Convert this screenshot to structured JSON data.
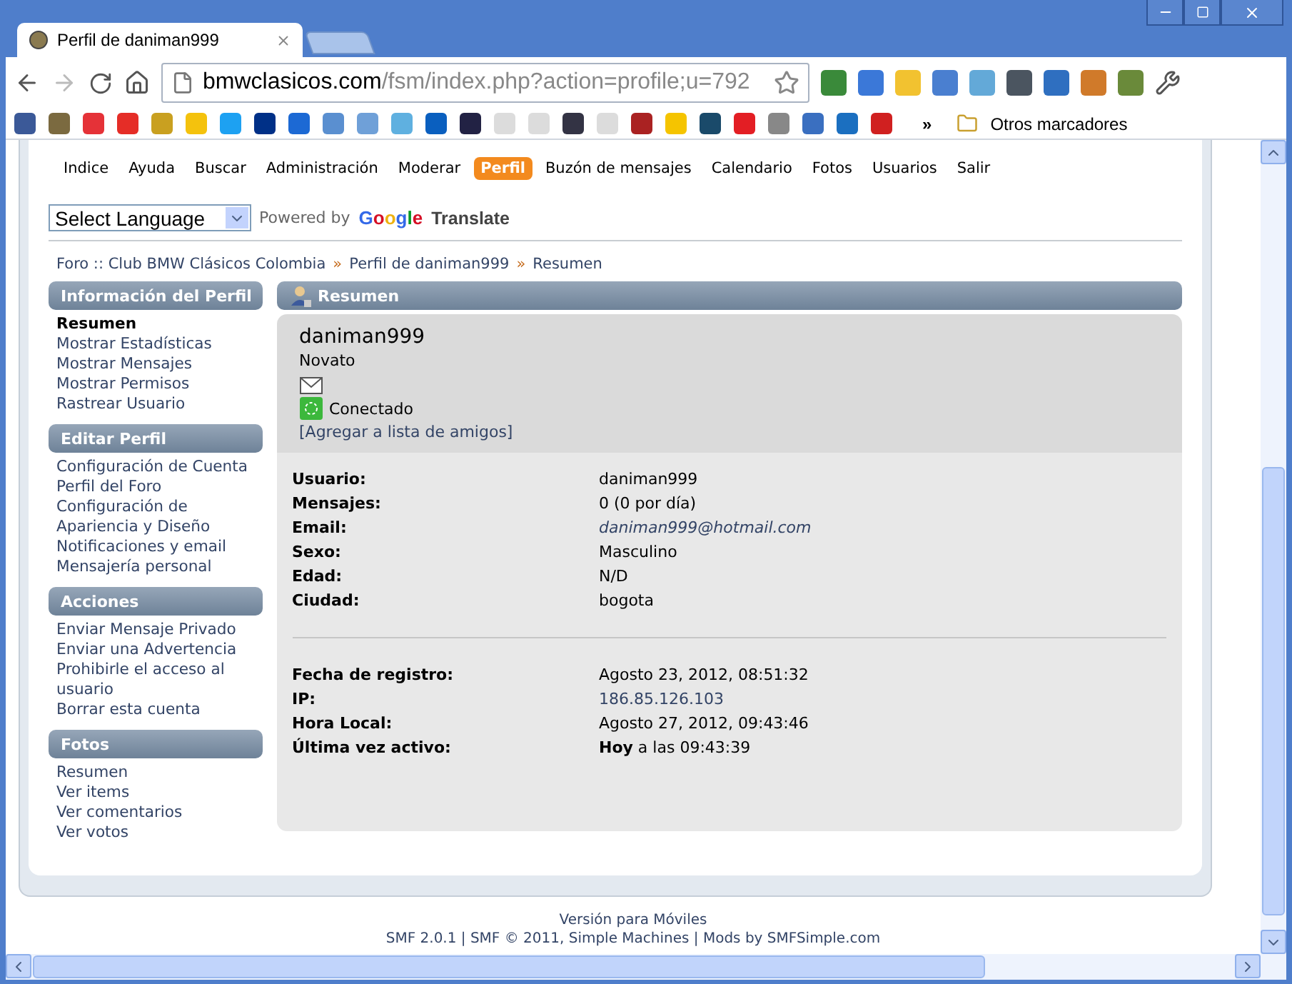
{
  "window": {
    "tab_title": "Perfil de daniman999",
    "url_domain": "bmwclasicos.com",
    "url_path": "/fsm/index.php?action=profile;u=792"
  },
  "bookmarks": {
    "more": "»",
    "other": "Otros marcadores"
  },
  "menu": [
    {
      "label": "Indice",
      "selected": false
    },
    {
      "label": "Ayuda",
      "selected": false
    },
    {
      "label": "Buscar",
      "selected": false
    },
    {
      "label": "Administración",
      "selected": false
    },
    {
      "label": "Moderar",
      "selected": false
    },
    {
      "label": "Perfil",
      "selected": true
    },
    {
      "label": "Buzón de mensajes",
      "selected": false
    },
    {
      "label": "Calendario",
      "selected": false
    },
    {
      "label": "Fotos",
      "selected": false
    },
    {
      "label": "Usuarios",
      "selected": false
    },
    {
      "label": "Salir",
      "selected": false
    }
  ],
  "translate": {
    "select": "Select Language",
    "powered_by": "Powered by",
    "brand": "Google",
    "product": "Translate"
  },
  "breadcrumb_separator": "»",
  "breadcrumb": [
    "Foro :: Club BMW Clásicos Colombia",
    "Perfil de daniman999",
    "Resumen"
  ],
  "sidebar": [
    {
      "title": "Información del Perfil",
      "items": [
        {
          "label": "Resumen",
          "selected": true
        },
        {
          "label": "Mostrar Estadísticas",
          "selected": false
        },
        {
          "label": "Mostrar Mensajes",
          "selected": false
        },
        {
          "label": "Mostrar Permisos",
          "selected": false
        },
        {
          "label": "Rastrear Usuario",
          "selected": false
        }
      ]
    },
    {
      "title": "Editar Perfil",
      "items": [
        {
          "label": "Configuración de Cuenta",
          "selected": false
        },
        {
          "label": "Perfil del Foro",
          "selected": false
        },
        {
          "label": "Configuración de Apariencia y Diseño",
          "selected": false
        },
        {
          "label": "Notificaciones y email",
          "selected": false
        },
        {
          "label": "Mensajería personal",
          "selected": false
        }
      ]
    },
    {
      "title": "Acciones",
      "items": [
        {
          "label": "Enviar Mensaje Privado",
          "selected": false
        },
        {
          "label": "Enviar una Advertencia",
          "selected": false
        },
        {
          "label": "Prohibirle el acceso al usuario",
          "selected": false
        },
        {
          "label": "Borrar esta cuenta",
          "selected": false
        }
      ]
    },
    {
      "title": "Fotos",
      "items": [
        {
          "label": "Resumen",
          "selected": false
        },
        {
          "label": "Ver items",
          "selected": false
        },
        {
          "label": "Ver comentarios",
          "selected": false
        },
        {
          "label": "Ver votos",
          "selected": false
        }
      ]
    }
  ],
  "summary": {
    "title": "Resumen",
    "username": "daniman999",
    "rank": "Novato",
    "online": true,
    "status": "Conectado",
    "add_buddy": "[Agregar a lista de amigos]"
  },
  "details": [
    [
      {
        "label": "Usuario:",
        "value": "daniman999",
        "kind": "text"
      },
      {
        "label": "Mensajes:",
        "value": "0 (0 por día)",
        "kind": "text"
      },
      {
        "label": "Email:",
        "value": "daniman999@hotmail.com",
        "kind": "email"
      },
      {
        "label": "Sexo:",
        "value": "Masculino",
        "kind": "text"
      },
      {
        "label": "Edad:",
        "value": "N/D",
        "kind": "text"
      },
      {
        "label": "Ciudad:",
        "value": "bogota",
        "kind": "text"
      }
    ],
    [
      {
        "label": "Fecha de registro:",
        "value": "Agosto 23, 2012, 08:51:32",
        "kind": "text"
      },
      {
        "label": "IP:",
        "value": "186.85.126.103",
        "kind": "link"
      },
      {
        "label": "Hora Local:",
        "value": "Agosto 27, 2012, 09:43:46",
        "kind": "text"
      },
      {
        "label": "Última vez activo:",
        "value": "**Hoy** a las 09:43:39",
        "kind": "text"
      }
    ]
  ],
  "footer": [
    "Versión para Móviles",
    "SMF 2.0.1 | SMF © 2011, Simple Machines | Mods by SMFSimple.com"
  ]
}
